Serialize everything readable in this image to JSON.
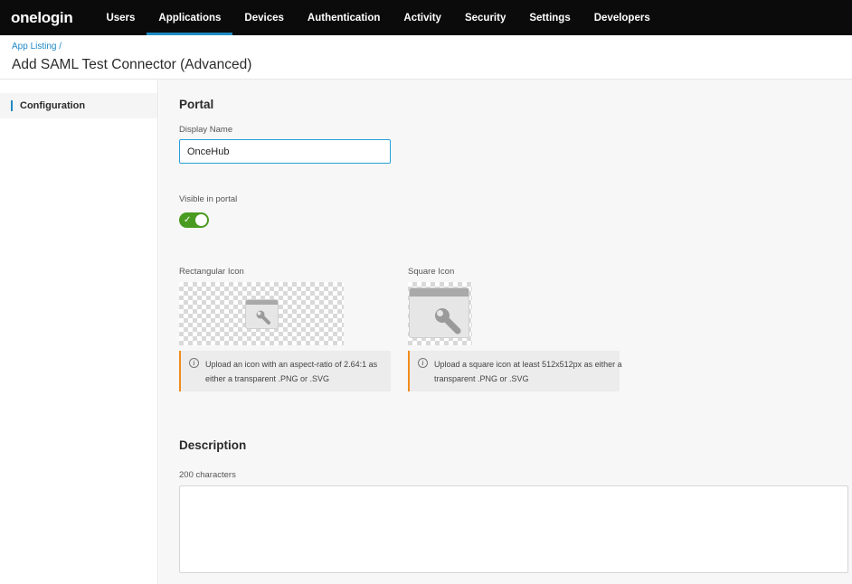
{
  "nav": {
    "logo": "onelogin",
    "items": [
      {
        "label": "Users"
      },
      {
        "label": "Applications"
      },
      {
        "label": "Devices"
      },
      {
        "label": "Authentication"
      },
      {
        "label": "Activity"
      },
      {
        "label": "Security"
      },
      {
        "label": "Settings"
      },
      {
        "label": "Developers"
      }
    ],
    "active": "Applications"
  },
  "header": {
    "breadcrumb_link": "App Listing",
    "breadcrumb_sep": " /",
    "title": "Add SAML Test Connector (Advanced)"
  },
  "sidebar": {
    "items": [
      {
        "label": "Configuration"
      }
    ]
  },
  "portal": {
    "heading": "Portal",
    "display_name_label": "Display Name",
    "display_name_value": "OnceHub",
    "visible_label": "Visible in portal",
    "visible_on": true,
    "rect_icon_label": "Rectangular Icon",
    "square_icon_label": "Square Icon",
    "rect_notice": "Upload an icon with an aspect-ratio of 2.64:1 as either a transparent .PNG or .SVG",
    "square_notice": "Upload a square icon at least 512x512px as either a transparent .PNG or .SVG"
  },
  "description": {
    "heading": "Description",
    "chars_label": "200 characters",
    "value": ""
  },
  "colors": {
    "accent": "#1e8bc3",
    "toggle_on": "#4a9b22",
    "notice_border": "#f08c1e",
    "nav_bg": "#0b0b0b"
  }
}
